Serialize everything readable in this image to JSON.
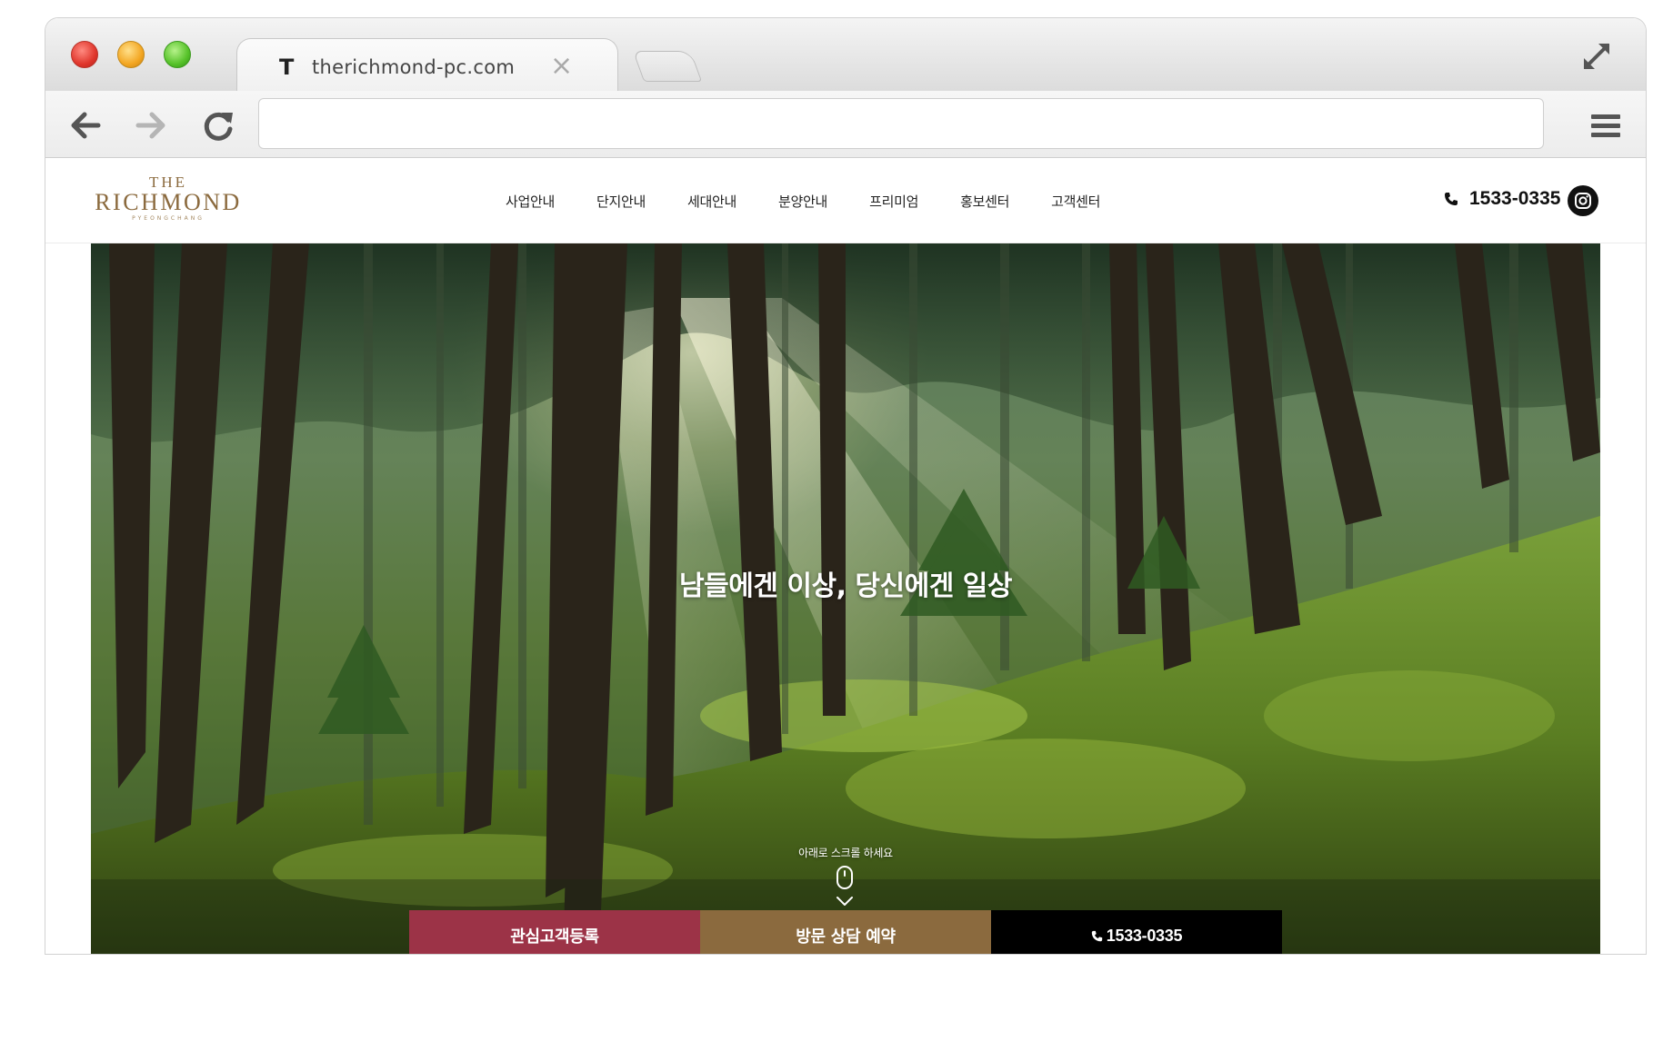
{
  "browser": {
    "tab": {
      "favicon": "T",
      "title": "therichmond-pc.com",
      "close": "×"
    },
    "address_bar": {
      "value": ""
    },
    "icons": [
      "back-arrow-icon",
      "forward-arrow-icon",
      "reload-icon",
      "hamburger-menu-icon",
      "expand-icon"
    ]
  },
  "site": {
    "logo": {
      "top": "THE",
      "main": "RICHMOND",
      "sub": "PYEONGCHANG"
    },
    "nav": {
      "items": [
        "사업안내",
        "단지안내",
        "세대안내",
        "분양안내",
        "프리미엄",
        "홍보센터",
        "고객센터"
      ]
    },
    "header": {
      "phone": "1533-0335",
      "instagram_icon": "instagram-icon"
    },
    "hero": {
      "headline": "남들에겐 이상, 당신에겐 일상",
      "scroll_hint": "아래로 스크롤 하세요",
      "background": "sunlit-forest-photo"
    },
    "cta": {
      "register": "관심고객등록",
      "visit": "방문 상담 예약",
      "call": "1533-0335"
    },
    "colors": {
      "brand_gold": "#8b6a3e",
      "register_red": "#9c3347",
      "call_black": "#000000"
    }
  }
}
